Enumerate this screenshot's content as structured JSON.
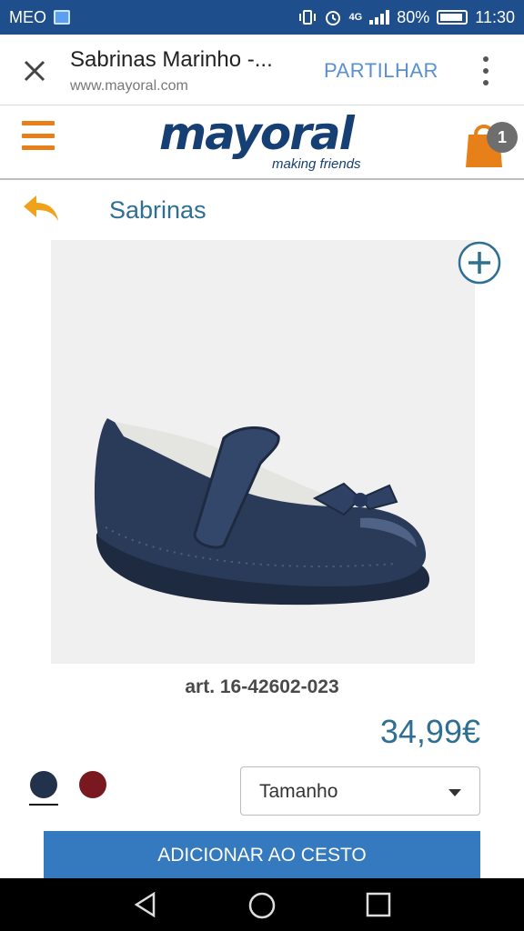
{
  "status_bar": {
    "carrier": "MEO",
    "network": "4G",
    "battery": "80%",
    "time": "11:30"
  },
  "browser": {
    "title": "Sabrinas Marinho -...",
    "url": "www.mayoral.com",
    "share_label": "PARTILHAR"
  },
  "site": {
    "logo_text": "mayoral",
    "logo_tagline": "making friends",
    "cart_count": "1"
  },
  "product": {
    "category": "Sabrinas",
    "article": "art. 16-42602-023",
    "price": "34,99€",
    "colors": [
      {
        "name": "navy",
        "hex": "#22324a",
        "selected": true
      },
      {
        "name": "wine",
        "hex": "#7a1820",
        "selected": false
      }
    ],
    "size_placeholder": "Tamanho",
    "add_to_cart_label": "ADICIONAR AO  CESTO"
  },
  "theme": {
    "accent_orange": "#e8801a",
    "brand_blue": "#163f73",
    "link_blue": "#2f6f93",
    "button_blue": "#3579bf",
    "status_bar_blue": "#1f4e8c"
  }
}
